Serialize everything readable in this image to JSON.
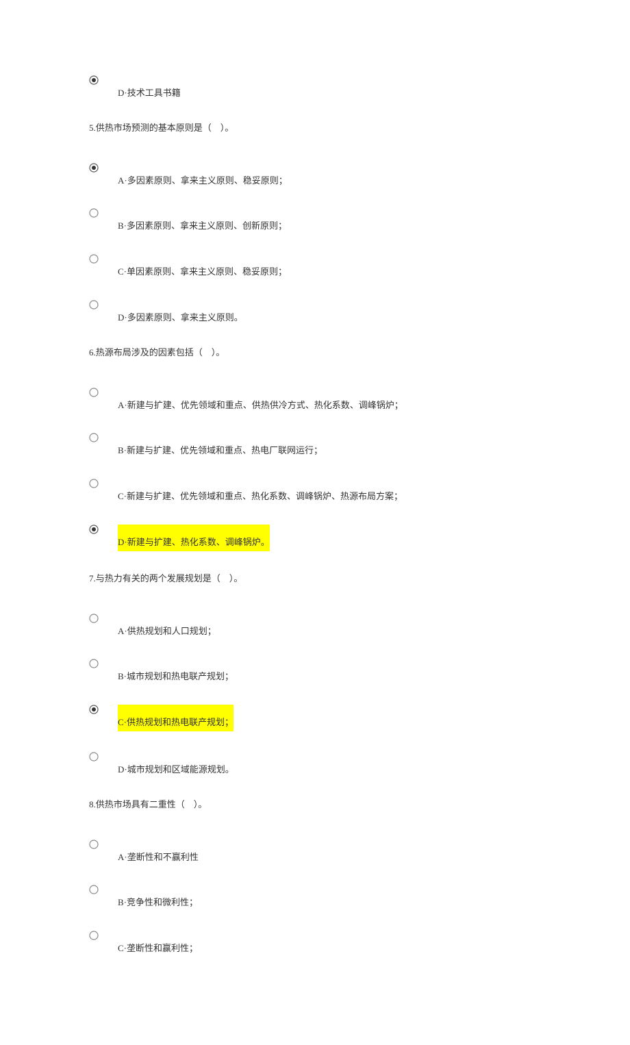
{
  "partial_option": {
    "label": "D·技术工具书籍"
  },
  "questions": [
    {
      "number": "5",
      "text": "5.供热市场预测的基本原则是（　）。",
      "options": [
        {
          "letter": "A",
          "text": "A·多因素原则、拿来主义原则、稳妥原则；",
          "selected": true,
          "highlighted": false
        },
        {
          "letter": "B",
          "text": "B·多因素原则、拿来主义原则、创新原则；",
          "selected": false,
          "highlighted": false
        },
        {
          "letter": "C",
          "text": "C·单因素原则、拿来主义原则、稳妥原则；",
          "selected": false,
          "highlighted": false
        },
        {
          "letter": "D",
          "text": "D·多因素原则、拿来主义原则。",
          "selected": false,
          "highlighted": false
        }
      ]
    },
    {
      "number": "6",
      "text": "6.热源布局涉及的因素包括（　）。",
      "options": [
        {
          "letter": "A",
          "text": "A·新建与扩建、优先领域和重点、供热供冷方式、热化系数、调峰锅炉；",
          "selected": false,
          "highlighted": false
        },
        {
          "letter": "B",
          "text": "B·新建与扩建、优先领域和重点、热电厂联网运行；",
          "selected": false,
          "highlighted": false
        },
        {
          "letter": "C",
          "text": "C·新建与扩建、优先领域和重点、热化系数、调峰锅炉、热源布局方案；",
          "selected": false,
          "highlighted": false
        },
        {
          "letter": "D",
          "text": "D·新建与扩建、热化系数、调峰锅炉。",
          "selected": true,
          "highlighted": true
        }
      ]
    },
    {
      "number": "7",
      "text": "7.与热力有关的两个发展规划是（　）。",
      "options": [
        {
          "letter": "A",
          "text": "A·供热规划和人口规划；",
          "selected": false,
          "highlighted": false
        },
        {
          "letter": "B",
          "text": "B·城市规划和热电联产规划；",
          "selected": false,
          "highlighted": false
        },
        {
          "letter": "C",
          "text": "C·供热规划和热电联产规划；",
          "selected": true,
          "highlighted": true
        },
        {
          "letter": "D",
          "text": "D·城市规划和区域能源规划。",
          "selected": false,
          "highlighted": false
        }
      ]
    },
    {
      "number": "8",
      "text": "8.供热市场具有二重性（　）。",
      "options": [
        {
          "letter": "A",
          "text": "A·垄断性和不赢利性",
          "selected": false,
          "highlighted": false
        },
        {
          "letter": "B",
          "text": "B·竞争性和微利性；",
          "selected": false,
          "highlighted": false
        },
        {
          "letter": "C",
          "text": "C·垄断性和赢利性；",
          "selected": false,
          "highlighted": false
        }
      ]
    }
  ],
  "footer": ""
}
